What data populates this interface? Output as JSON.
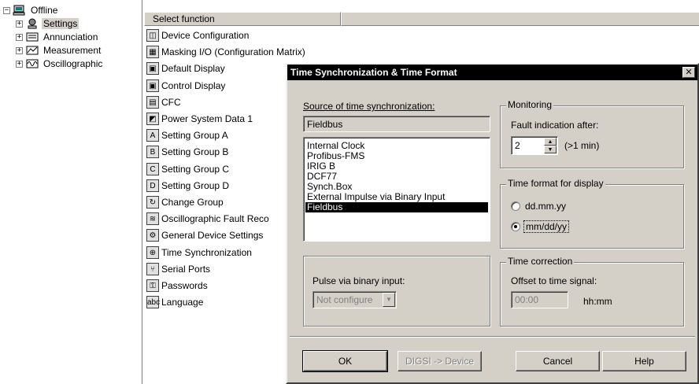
{
  "tree": {
    "root": "Offline",
    "children": [
      "Settings",
      "Annunciation",
      "Measurement",
      "Oscillographic"
    ],
    "selected": "Settings"
  },
  "function_list": {
    "header": "Select function",
    "items": [
      {
        "label": "Device Configuration",
        "icon": "device-config-icon"
      },
      {
        "label": "Masking I/O (Configuration Matrix)",
        "icon": "matrix-icon"
      },
      {
        "label": "Default Display",
        "icon": "default-display-icon"
      },
      {
        "label": "Control Display",
        "icon": "control-display-icon"
      },
      {
        "label": "CFC",
        "icon": "cfc-icon"
      },
      {
        "label": "Power System Data 1",
        "icon": "power-system-icon"
      },
      {
        "label": "Setting Group A",
        "icon": "setting-group-a-icon"
      },
      {
        "label": "Setting Group B",
        "icon": "setting-group-b-icon"
      },
      {
        "label": "Setting Group C",
        "icon": "setting-group-c-icon"
      },
      {
        "label": "Setting Group D",
        "icon": "setting-group-d-icon"
      },
      {
        "label": "Change Group",
        "icon": "change-group-icon"
      },
      {
        "label": "Oscillographic Fault Reco",
        "icon": "oscillographic-icon"
      },
      {
        "label": "General Device Settings",
        "icon": "general-settings-icon"
      },
      {
        "label": "Time Synchronization",
        "icon": "time-sync-icon"
      },
      {
        "label": "Serial Ports",
        "icon": "serial-ports-icon"
      },
      {
        "label": "Passwords",
        "icon": "key-icon"
      },
      {
        "label": "Language",
        "icon": "language-icon"
      }
    ]
  },
  "dialog": {
    "title": "Time Synchronization & Time Format",
    "close_glyph": "✕",
    "source_label": "Source of time synchronization:",
    "source_value": "Fieldbus",
    "source_options": [
      "Internal Clock",
      "Profibus-FMS",
      "IRIG B",
      "DCF77",
      "Synch.Box",
      "External Impulse via Binary Input",
      "Fieldbus"
    ],
    "source_selected_index": 6,
    "pulse_label": "Pulse via binary input:",
    "pulse_value": "Not configure",
    "monitoring": {
      "title": "Monitoring",
      "fault_label": "Fault indication after:",
      "fault_value": "2",
      "fault_unit": "(>1 min)"
    },
    "time_format": {
      "title": "Time format for display",
      "options": [
        "dd.mm.yy",
        "mm/dd/yy"
      ],
      "selected_index": 1
    },
    "time_correction": {
      "title": "Time correction",
      "offset_label": "Offset to time signal:",
      "offset_value": "00:00",
      "offset_unit": "hh:mm"
    },
    "buttons": {
      "ok": "OK",
      "digsi": "DIGSI -> Device",
      "cancel": "Cancel",
      "help": "Help"
    }
  }
}
